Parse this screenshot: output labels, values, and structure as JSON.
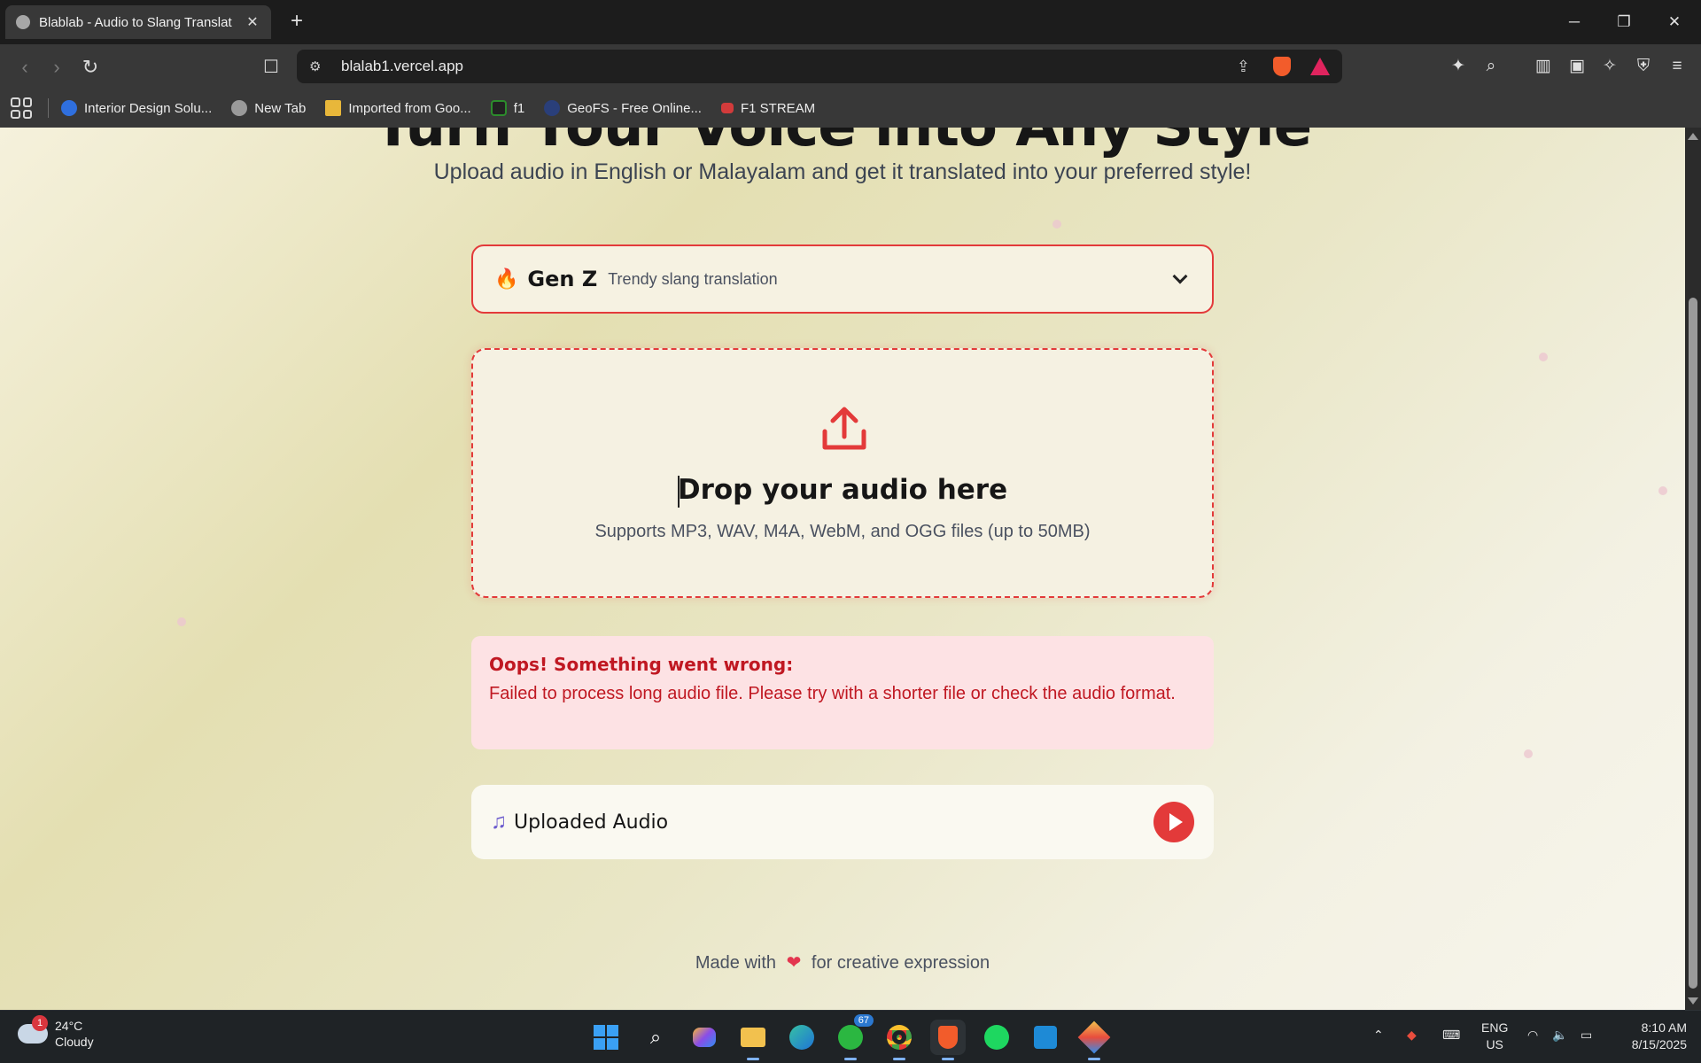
{
  "browser": {
    "tab_title": "Blablab - Audio to Slang Translat",
    "url": "blalab1.vercel.app",
    "bookmarks": [
      {
        "label": "Interior Design Solu...",
        "color": "#2f6fde"
      },
      {
        "label": "New Tab",
        "color": "#9a9a9a"
      },
      {
        "label": "Imported from Goo...",
        "color": "#e8b73a"
      },
      {
        "label": "f1",
        "color": "#2c8c2c"
      },
      {
        "label": "GeoFS - Free Online...",
        "color": "#2a3f7a"
      },
      {
        "label": "F1 STREAM",
        "color": "#d23b3b"
      }
    ]
  },
  "page": {
    "hero_title": "Turn Your Voice into Any Style",
    "hero_subtitle": "Upload audio in English or Malayalam and get it translated into your preferred style!",
    "style_selector": {
      "emoji": "🔥",
      "name": "Gen Z",
      "description": "Trendy slang translation"
    },
    "dropzone": {
      "title": "Drop your audio here",
      "subtitle": "Supports MP3, WAV, M4A, WebM, and OGG files (up to 50MB)"
    },
    "error": {
      "title": "Oops! Something went wrong:",
      "message": "Failed to process long audio file. Please try with a shorter file or check the audio format."
    },
    "audio": {
      "label": "Uploaded Audio"
    },
    "footer": {
      "prefix": "Made with",
      "heart": "❤",
      "suffix": "for creative expression"
    },
    "accent_color": "#e33a3a"
  },
  "taskbar": {
    "weather_badge": "1",
    "temperature": "24°C",
    "condition": "Cloudy",
    "whatsapp_badge": "67",
    "lang_1": "ENG",
    "lang_2": "US",
    "time": "8:10 AM",
    "date": "8/15/2025"
  }
}
